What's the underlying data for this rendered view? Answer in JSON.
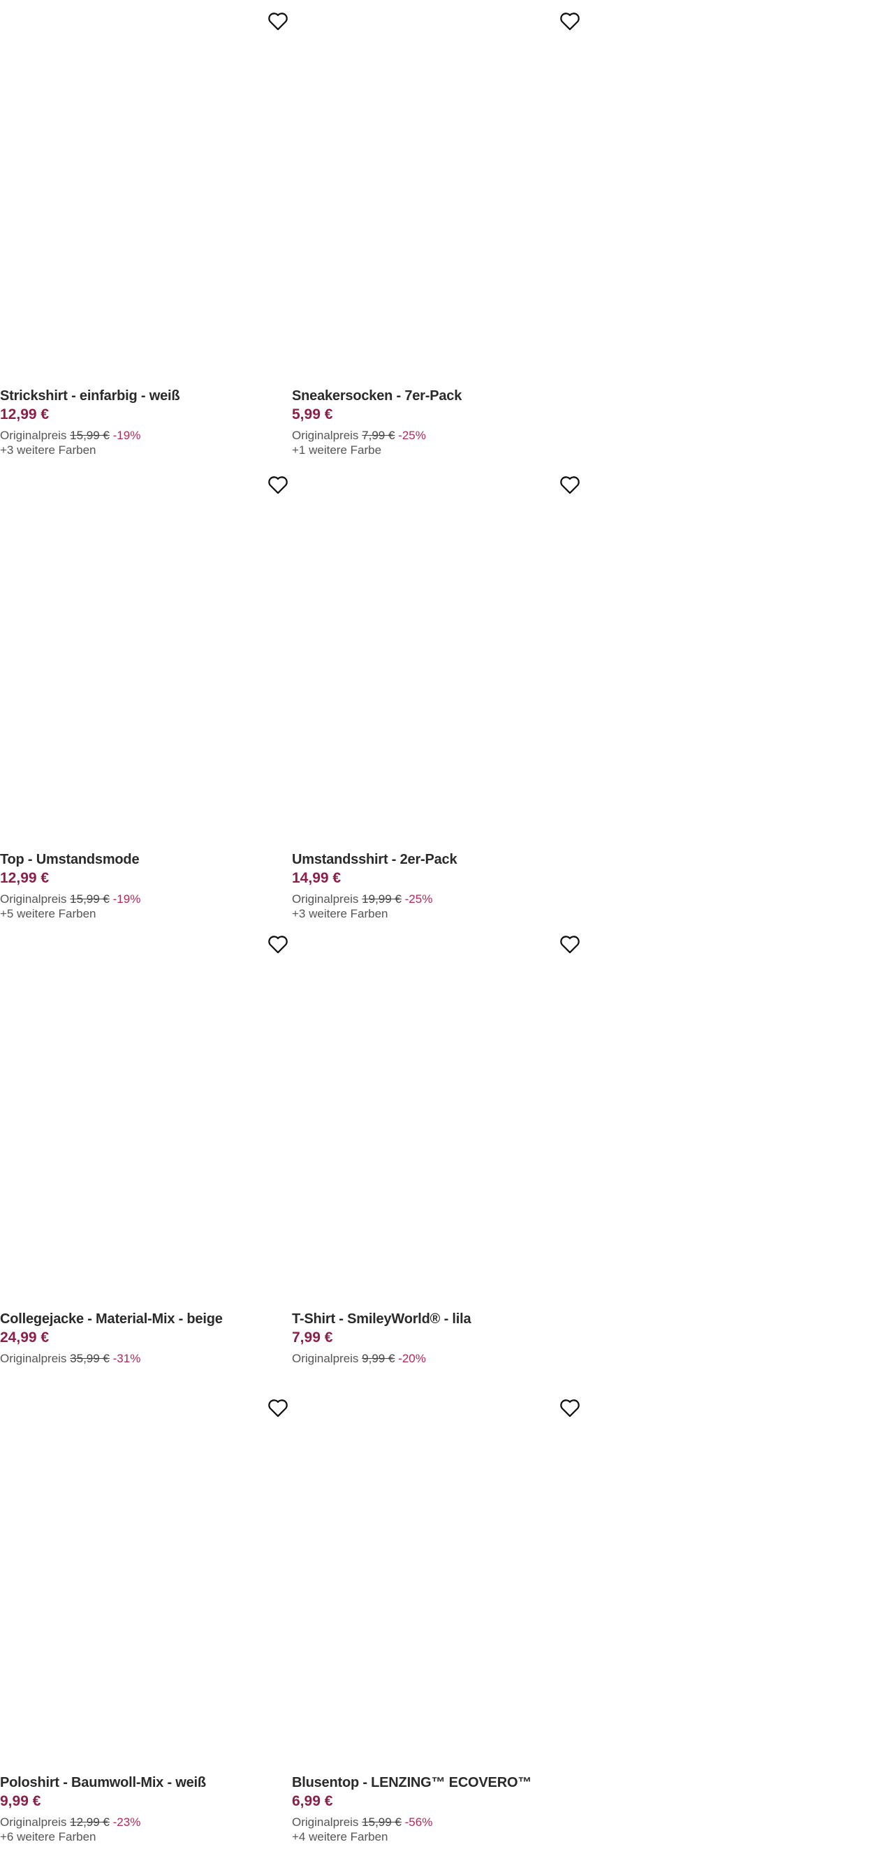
{
  "colors": {
    "price": "#8c1f4a",
    "discount": "#b02a55",
    "text": "#2a2a2a",
    "muted": "#555555"
  },
  "labels": {
    "original_price": "Originalpreis"
  },
  "products": [
    {
      "title": "Strickshirt - einfarbig - weiß",
      "price": "12,99 €",
      "original_price": "15,99 €",
      "discount": "-19%",
      "more_colors": "+3 weitere Farben",
      "wishlist_icon": "heart-outline-icon"
    },
    {
      "title": "Sneakersocken - 7er-Pack",
      "price": "5,99 €",
      "original_price": "7,99 €",
      "discount": "-25%",
      "more_colors": "+1 weitere Farbe",
      "wishlist_icon": "heart-outline-icon"
    },
    {
      "title": "Top - Umstandsmode",
      "price": "12,99 €",
      "original_price": "15,99 €",
      "discount": "-19%",
      "more_colors": "+5 weitere Farben",
      "wishlist_icon": "heart-outline-icon"
    },
    {
      "title": "Umstandsshirt - 2er-Pack",
      "price": "14,99 €",
      "original_price": "19,99 €",
      "discount": "-25%",
      "more_colors": "+3 weitere Farben",
      "wishlist_icon": "heart-outline-icon"
    },
    {
      "title": "Collegejacke - Material-Mix - beige",
      "price": "24,99 €",
      "original_price": "35,99 €",
      "discount": "-31%",
      "more_colors": "",
      "wishlist_icon": "heart-outline-icon"
    },
    {
      "title": "T-Shirt - SmileyWorld® - lila",
      "price": "7,99 €",
      "original_price": "9,99 €",
      "discount": "-20%",
      "more_colors": "",
      "wishlist_icon": "heart-outline-icon"
    },
    {
      "title": "Poloshirt - Baumwoll-Mix - weiß",
      "price": "9,99 €",
      "original_price": "12,99 €",
      "discount": "-23%",
      "more_colors": "+6 weitere Farben",
      "wishlist_icon": "heart-outline-icon"
    },
    {
      "title": "Blusentop - LENZING™ ECOVERO™",
      "price": "6,99 €",
      "original_price": "15,99 €",
      "discount": "-56%",
      "more_colors": "+4 weitere Farben",
      "wishlist_icon": "heart-outline-icon"
    }
  ]
}
